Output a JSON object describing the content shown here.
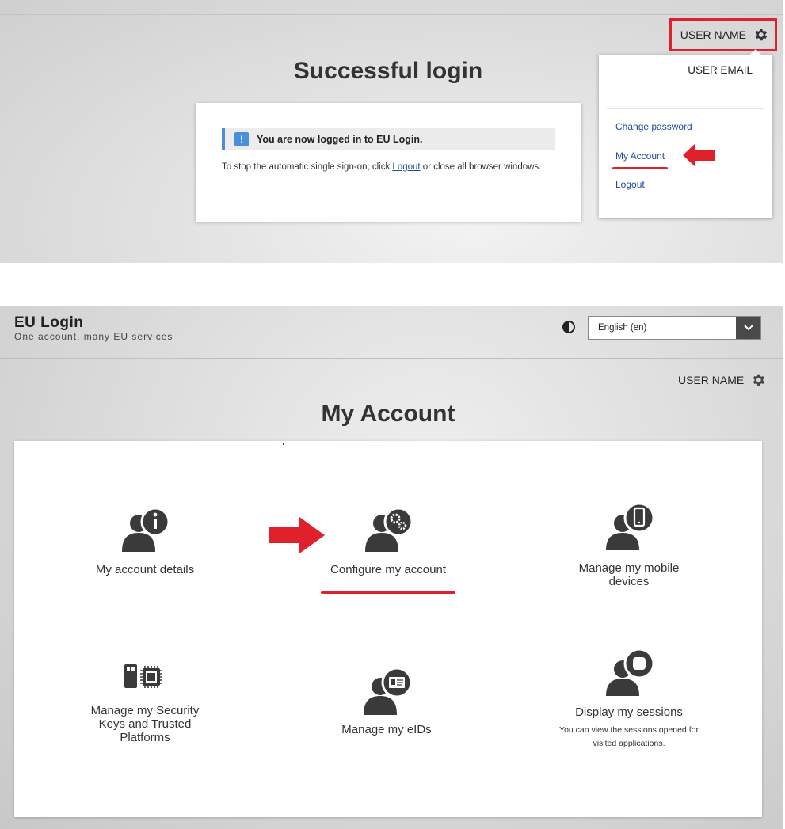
{
  "top": {
    "user_name": "USER NAME",
    "title": "Successful login",
    "notice": "You are now logged in to EU Login.",
    "info_prefix": "To stop the automatic single sign-on, click ",
    "info_link": "Logout",
    "info_suffix": " or close all browser windows.",
    "dropdown": {
      "email": "USER EMAIL",
      "items": [
        {
          "label": "Change password"
        },
        {
          "label": "My Account"
        },
        {
          "label": "Logout"
        }
      ]
    }
  },
  "bottom": {
    "brand_title": "EU Login",
    "brand_sub": "One account, many EU services",
    "language": "English (en)",
    "user_name": "USER NAME",
    "title": "My Account",
    "tiles": [
      {
        "label": "My account details",
        "icon": "person-info-icon"
      },
      {
        "label": "Configure my account",
        "icon": "person-gears-icon"
      },
      {
        "label": "Manage my mobile devices",
        "icon": "person-mobile-icon"
      },
      {
        "label": "Manage my Security Keys and Trusted Platforms",
        "icon": "security-key-chip-icon"
      },
      {
        "label": "Manage my eIDs",
        "icon": "person-id-card-icon"
      },
      {
        "label": "Display my sessions",
        "desc": "You can view the sessions opened for visited applications.",
        "icon": "person-session-icon"
      }
    ]
  },
  "colors": {
    "highlight": "#e0202b",
    "link": "#1a4ca3",
    "notice_accent": "#4a90d9",
    "icon": "#3a3a3a"
  }
}
